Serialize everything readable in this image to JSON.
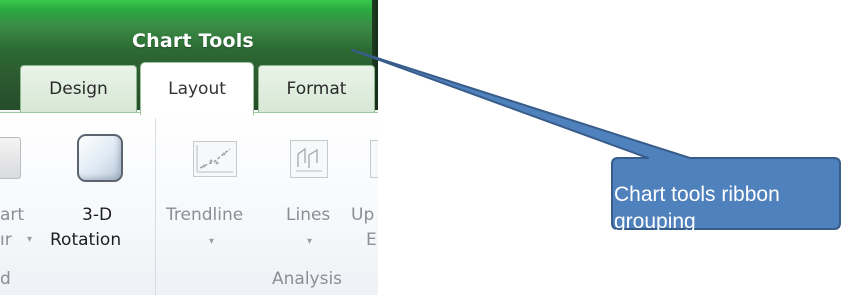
{
  "ribbon": {
    "context_title": "Chart Tools",
    "tabs": [
      {
        "label": "Design"
      },
      {
        "label": "Layout"
      },
      {
        "label": "Format"
      }
    ],
    "buttons": {
      "partial_left_line1": "art",
      "partial_left_line2": "ır",
      "rotation_line1": "3-D",
      "rotation_line2": "Rotation",
      "trendline": "Trendline",
      "lines": "Lines",
      "partial_right_line1": "Up",
      "partial_right_line2": "E"
    },
    "groups": {
      "partial_left": "d",
      "analysis": "Analysis"
    }
  },
  "callout": {
    "text_line1": "Chart tools ribbon",
    "text_line2": "grouping",
    "fill": "#4f81bd",
    "border": "#385d8a"
  }
}
